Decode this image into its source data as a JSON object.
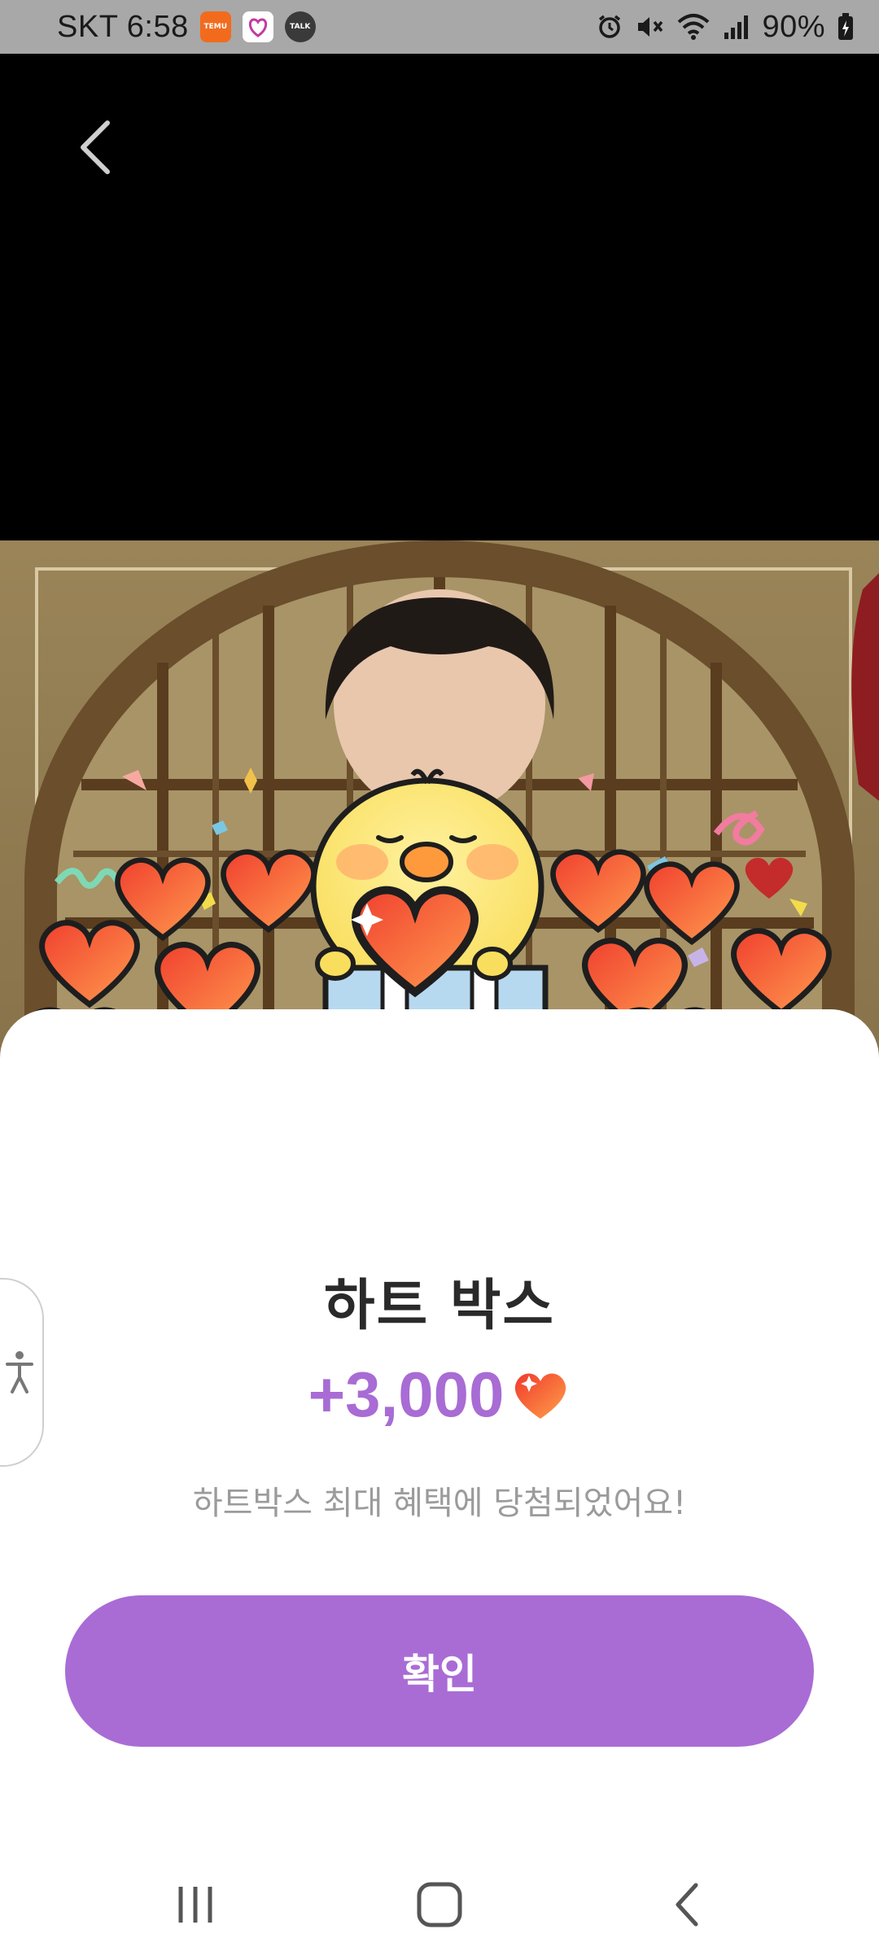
{
  "status_bar": {
    "carrier_time": "SKT 6:58",
    "apps": [
      {
        "name": "temu-icon",
        "label": "TEMU",
        "color": "#f26b1d"
      },
      {
        "name": "heart-app-icon",
        "label": "",
        "color": "#ffffff"
      },
      {
        "name": "kakao-talk-icon",
        "label": "TALK",
        "color": "#3a3a3a"
      }
    ],
    "battery": "90%"
  },
  "dialog": {
    "title": "하트 박스",
    "reward_amount": "+3,000",
    "message": "하트박스 최대 혜택에 당첨되었어요!",
    "confirm_label": "확인"
  },
  "colors": {
    "accent": "#a96cd5",
    "heart": "#f25a3a"
  }
}
